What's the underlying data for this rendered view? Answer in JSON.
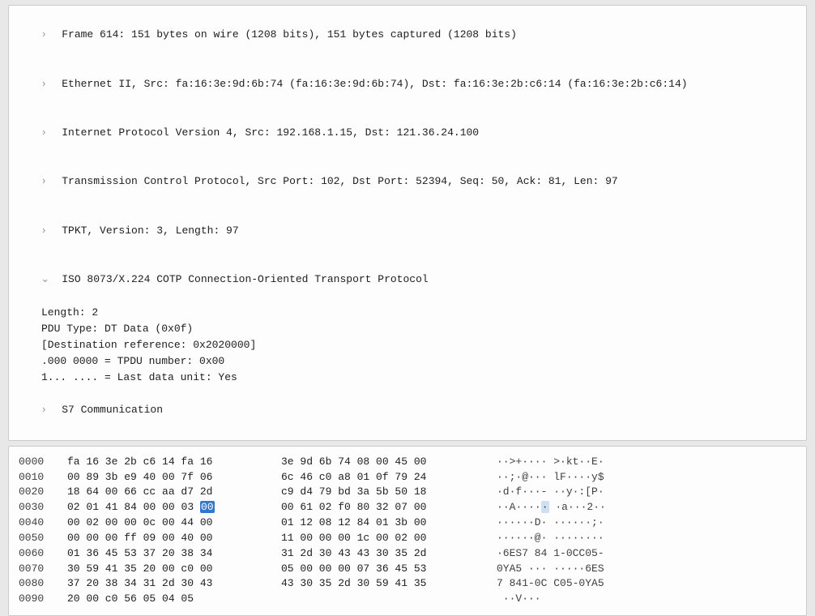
{
  "details": {
    "frame": "Frame 614: 151 bytes on wire (1208 bits), 151 bytes captured (1208 bits)",
    "eth": "Ethernet II, Src: fa:16:3e:9d:6b:74 (fa:16:3e:9d:6b:74), Dst: fa:16:3e:2b:c6:14 (fa:16:3e:2b:c6:14)",
    "ip": "Internet Protocol Version 4, Src: 192.168.1.15, Dst: 121.36.24.100",
    "tcp": "Transmission Control Protocol, Src Port: 102, Dst Port: 52394, Seq: 50, Ack: 81, Len: 97",
    "tpkt": "TPKT, Version: 3, Length: 97",
    "cotp": "ISO 8073/X.224 COTP Connection-Oriented Transport Protocol",
    "cotp_children": {
      "length": "Length: 2",
      "pdu": "PDU Type: DT Data (0x0f)",
      "dstref": "[Destination reference: 0x2020000]",
      "tpdunum": ".000 0000 = TPDU number: 0x00",
      "last": "1... .... = Last data unit: Yes"
    },
    "s7": "S7 Communication"
  },
  "arrows": {
    "collapsed": "›",
    "expanded": "⌄"
  },
  "hex": {
    "highlight_row": 3,
    "highlight_hex_col": 7,
    "highlight_ascii_col": 7,
    "rows": [
      {
        "off": "0000",
        "b1": "fa 16 3e 2b c6 14 fa 16",
        "b2": "3e 9d 6b 74 08 00 45 00",
        "ascii": "··>+···· >·kt··E·"
      },
      {
        "off": "0010",
        "b1": "00 89 3b e9 40 00 7f 06",
        "b2": "6c 46 c0 a8 01 0f 79 24",
        "ascii": "··;·@··· lF····y$"
      },
      {
        "off": "0020",
        "b1": "18 64 00 66 cc aa d7 2d",
        "b2": "c9 d4 79 bd 3a 5b 50 18",
        "ascii": "·d·f···- ··y·:[P·"
      },
      {
        "off": "0030",
        "b1": "02 01 41 84 00 00 03 00",
        "b2": "00 61 02 f0 80 32 07 00",
        "ascii": "··A····· ·a···2··"
      },
      {
        "off": "0040",
        "b1": "00 02 00 00 0c 00 44 00",
        "b2": "01 12 08 12 84 01 3b 00",
        "ascii": "······D· ······;·"
      },
      {
        "off": "0050",
        "b1": "00 00 00 ff 09 00 40 00",
        "b2": "11 00 00 00 1c 00 02 00",
        "ascii": "······@· ········"
      },
      {
        "off": "0060",
        "b1": "01 36 45 53 37 20 38 34",
        "b2": "31 2d 30 43 43 30 35 2d",
        "ascii": "·6ES7 84 1-0CC05-"
      },
      {
        "off": "0070",
        "b1": "30 59 41 35 20 00 c0 00",
        "b2": "05 00 00 00 07 36 45 53",
        "ascii": "0YA5 ··· ·····6ES"
      },
      {
        "off": "0080",
        "b1": "37 20 38 34 31 2d 30 43",
        "b2": "43 30 35 2d 30 59 41 35",
        "ascii": "7 841-0C C05-0YA5"
      },
      {
        "off": "0090",
        "b1": "20 00 c0 56 05 04 05",
        "b2": "",
        "ascii": " ··V···"
      }
    ]
  }
}
